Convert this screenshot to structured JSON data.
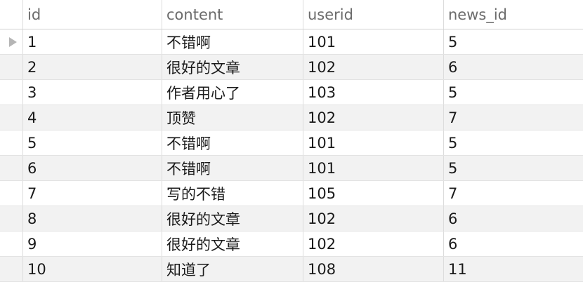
{
  "table": {
    "columns": [
      "id",
      "content",
      "userid",
      "news_id"
    ],
    "rows": [
      {
        "id": "1",
        "content": "不错啊",
        "userid": "101",
        "news_id": "5"
      },
      {
        "id": "2",
        "content": "很好的文章",
        "userid": "102",
        "news_id": "6"
      },
      {
        "id": "3",
        "content": "作者用心了",
        "userid": "103",
        "news_id": "5"
      },
      {
        "id": "4",
        "content": "顶赞",
        "userid": "102",
        "news_id": "7"
      },
      {
        "id": "5",
        "content": "不错啊",
        "userid": "101",
        "news_id": "5"
      },
      {
        "id": "6",
        "content": "不错啊",
        "userid": "101",
        "news_id": "5"
      },
      {
        "id": "7",
        "content": "写的不错",
        "userid": "105",
        "news_id": "7"
      },
      {
        "id": "8",
        "content": "很好的文章",
        "userid": "102",
        "news_id": "6"
      },
      {
        "id": "9",
        "content": "很好的文章",
        "userid": "102",
        "news_id": "6"
      },
      {
        "id": "10",
        "content": "知道了",
        "userid": "108",
        "news_id": "11"
      }
    ],
    "current_row_index": 0,
    "colors": {
      "header_text": "#6b6b6b",
      "cell_text": "#1a1a1a",
      "stripe": "#f2f2f2",
      "grid_line": "#dcdcdc",
      "row_marker": "#b5b5b5"
    },
    "icons": {
      "row_marker": "current-row-triangle-icon"
    }
  }
}
